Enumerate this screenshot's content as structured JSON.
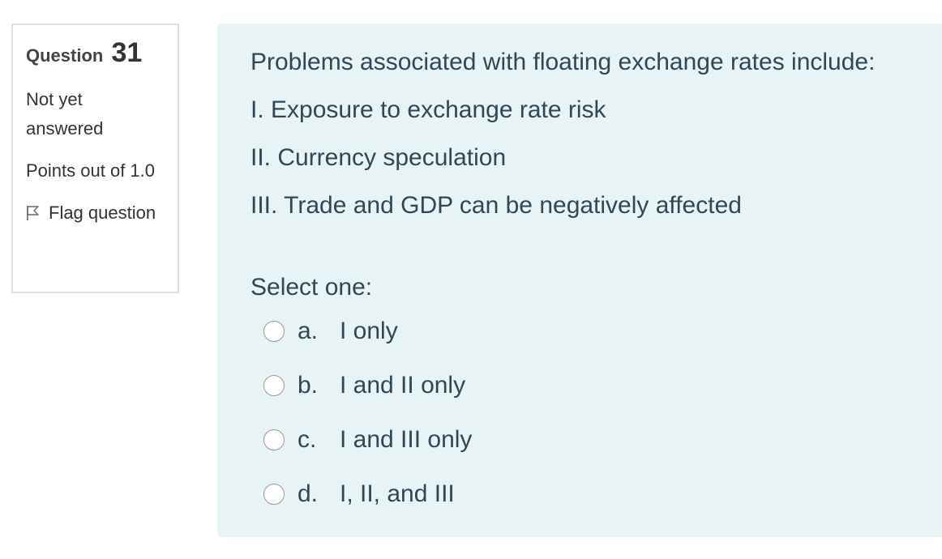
{
  "question_info": {
    "prefix": "Question",
    "number": "31",
    "state": "Not yet answered",
    "grade": "Points out of 1.0",
    "flag_label": "Flag question"
  },
  "question": {
    "text": "Problems associated with floating exchange rates include:",
    "statements": [
      "I. Exposure to exchange rate risk",
      "II. Currency speculation",
      "III. Trade and GDP can be negatively affected"
    ],
    "prompt": "Select one:",
    "options": [
      {
        "letter": "a.",
        "label": "I only"
      },
      {
        "letter": "b.",
        "label": "I and II only"
      },
      {
        "letter": "c.",
        "label": "I and III only"
      },
      {
        "letter": "d.",
        "label": "I, II, and III"
      }
    ]
  },
  "colors": {
    "content_bg": "#e7f3f5",
    "text": "#2f4858",
    "border": "#dedede"
  },
  "icons": {
    "flag": "flag-icon"
  }
}
